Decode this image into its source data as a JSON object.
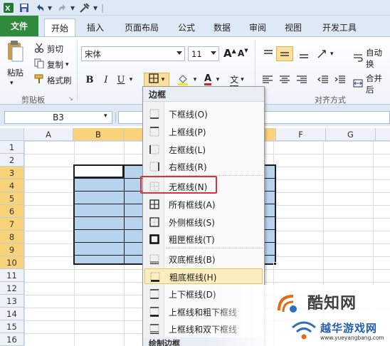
{
  "quick_access": {
    "undo_icon": "undo-icon",
    "redo_icon": "redo-icon"
  },
  "tabs": [
    {
      "id": "file",
      "label": "文件"
    },
    {
      "id": "home",
      "label": "开始"
    },
    {
      "id": "insert",
      "label": "插入"
    },
    {
      "id": "layout",
      "label": "页面布局"
    },
    {
      "id": "formulas",
      "label": "公式"
    },
    {
      "id": "data",
      "label": "数据"
    },
    {
      "id": "review",
      "label": "审阅"
    },
    {
      "id": "view",
      "label": "视图"
    },
    {
      "id": "developer",
      "label": "开发工具"
    }
  ],
  "clipboard": {
    "paste": "粘贴",
    "cut": "剪切",
    "copy": "复制",
    "copy_arrow": "▾",
    "format_painter": "格式刷",
    "group_label": "剪贴板"
  },
  "font": {
    "name": "宋体",
    "size": "11",
    "bold": "B",
    "italic": "I",
    "underline": "U",
    "grow": "A",
    "shrink": "A",
    "font_color": "A",
    "wen": "文"
  },
  "alignment": {
    "wrap_text": "自动换",
    "merge": "合并后",
    "group_label": "对齐方式"
  },
  "name_box": "B3",
  "columns": [
    "A",
    "B",
    "C",
    "D",
    "E",
    "F",
    "G"
  ],
  "rows": [
    "1",
    "2",
    "3",
    "4",
    "5",
    "6",
    "7",
    "8",
    "9",
    "10",
    "11",
    "12",
    "13",
    "14",
    "15",
    "16"
  ],
  "border_menu": {
    "title": "边框",
    "items": [
      {
        "label": "下框线(O)",
        "icon": "bottom-border-icon"
      },
      {
        "label": "上框线(P)",
        "icon": "top-border-icon"
      },
      {
        "label": "左框线(L)",
        "icon": "left-border-icon"
      },
      {
        "label": "右框线(R)",
        "icon": "right-border-icon"
      },
      {
        "label": "无框线(N)",
        "icon": "no-border-icon"
      },
      {
        "label": "所有框线(A)",
        "icon": "all-borders-icon"
      },
      {
        "label": "外侧框线(S)",
        "icon": "outside-borders-icon"
      },
      {
        "label": "粗匣框线(T)",
        "icon": "thick-box-border-icon"
      },
      {
        "label": "双底框线(B)",
        "icon": "double-bottom-border-icon"
      },
      {
        "label": "粗底框线(H)",
        "icon": "thick-bottom-border-icon"
      },
      {
        "label": "上下框线(D)",
        "icon": "top-bottom-border-icon"
      },
      {
        "label": "上框线和粗下框线",
        "icon": "top-thick-bottom-border-icon"
      },
      {
        "label": "上框线和双下框线",
        "icon": "top-double-bottom-border-icon"
      }
    ],
    "footer": "绘制边框"
  },
  "watermark": {
    "main": "酷知网",
    "sub": "越华游戏网",
    "url": "www.yueyangbang.com"
  },
  "colors": {
    "file_tab": "#2f8a3b",
    "selection_fill": "#b7d3ee",
    "header_selected": "#f9d27a",
    "highlight_item": "#fcedbd",
    "callout_box": "#d9333a"
  }
}
